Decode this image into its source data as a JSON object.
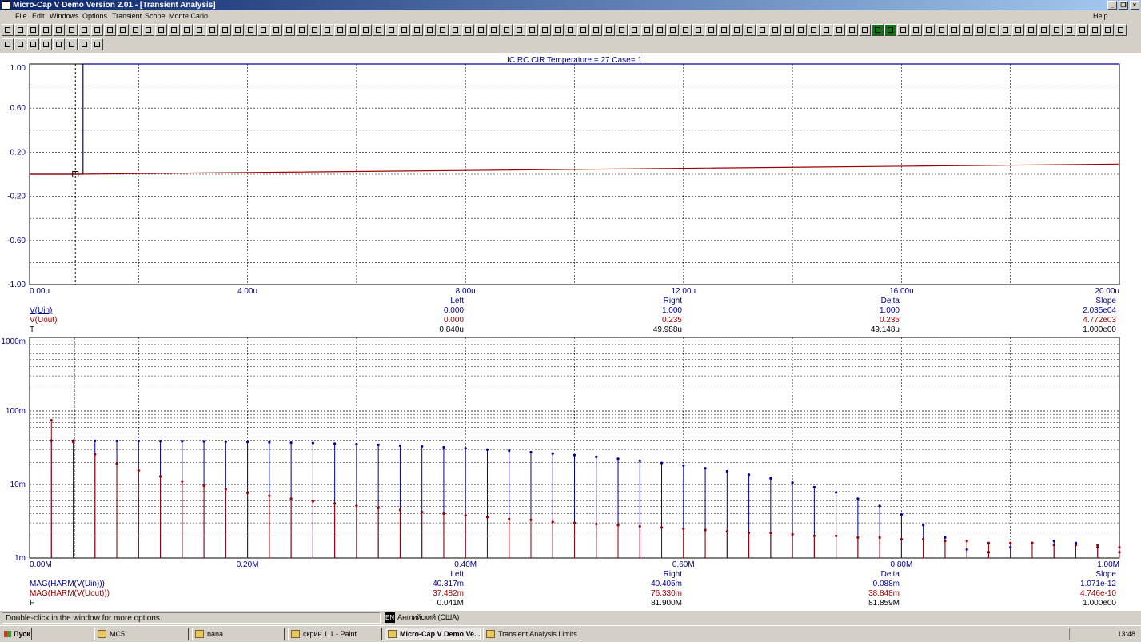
{
  "window": {
    "title": "Micro-Cap V Demo Version 2.01 - [Transient Analysis]",
    "help": "Help"
  },
  "menu": [
    "File",
    "Edit",
    "Windows",
    "Options",
    "Transient",
    "Scope",
    "Monte Carlo"
  ],
  "chart_data": [
    {
      "type": "line",
      "title": "IC  RC.CIR Temperature = 27 Case= 1",
      "xlim": [
        0,
        20
      ],
      "ylim": [
        -1.0,
        1.0
      ],
      "x_ticks": [
        "0.00u",
        "4.00u",
        "8.00u",
        "12.00u",
        "16.00u",
        "20.00u"
      ],
      "y_ticks": [
        "1.00",
        "0.60",
        "0.20",
        "-0.20",
        "-0.60",
        "-1.00"
      ],
      "grid": true,
      "series": [
        {
          "name": "V(Uin)",
          "color": "#0000a0",
          "x": [
            0,
            0.84,
            0.84,
            0.98,
            0.98,
            20
          ],
          "y": [
            0,
            0,
            0,
            0,
            1.0,
            1.0
          ]
        },
        {
          "name": "V(Uout)",
          "color": "#a00000",
          "x": [
            0,
            0.84,
            4,
            8,
            12,
            16,
            20
          ],
          "y": [
            0,
            0,
            0.016,
            0.035,
            0.054,
            0.073,
            0.092
          ]
        }
      ],
      "cursor": {
        "left_x": 0.84,
        "marker_y": 0
      },
      "readout": {
        "headers": [
          "Left",
          "Right",
          "Delta",
          "Slope"
        ],
        "rows": [
          {
            "label": "V(Uin)",
            "color": "#0000a0",
            "values": [
              "0.000",
              "1.000",
              "1.000",
              "2.035e04"
            ]
          },
          {
            "label": "V(Uout)",
            "color": "#a00000",
            "values": [
              "0.000",
              "0.235",
              "0.235",
              "4.772e03"
            ]
          },
          {
            "label": "T",
            "color": "#000000",
            "values": [
              "0.840u",
              "49.988u",
              "49.148u",
              "1.000e00"
            ]
          }
        ]
      }
    },
    {
      "type": "bar",
      "subtype": "stem",
      "xlim": [
        0,
        1.0
      ],
      "ylim": [
        0.001,
        1.0
      ],
      "y_scale": "log",
      "x_ticks": [
        "0.00M",
        "0.20M",
        "0.40M",
        "0.60M",
        "0.80M",
        "1.00M"
      ],
      "y_ticks": [
        "1000m",
        "100m",
        "10m",
        "1m"
      ],
      "grid": true,
      "harmonics": {
        "spacing": 0.02,
        "blue": [
          0.0395,
          0.0394,
          0.0393,
          0.0392,
          0.0391,
          0.039,
          0.0388,
          0.0386,
          0.0383,
          0.038,
          0.0376,
          0.0371,
          0.0366,
          0.036,
          0.0353,
          0.0346,
          0.0338,
          0.0329,
          0.032,
          0.031,
          0.0299,
          0.0288,
          0.0276,
          0.0264,
          0.0251,
          0.0238,
          0.0224,
          0.021,
          0.0196,
          0.0181,
          0.0166,
          0.0151,
          0.0136,
          0.0121,
          0.0106,
          0.0092,
          0.0078,
          0.0064,
          0.0051,
          0.0039,
          0.0028,
          0.0019,
          0.0013,
          0.0012,
          0.0014,
          0.0016,
          0.0017,
          0.0016,
          0.0014,
          0.0012,
          0.0011
        ],
        "red": [
          0.0749,
          0.038,
          0.0258,
          0.0193,
          0.0155,
          0.0129,
          0.011,
          0.0096,
          0.0086,
          0.0077,
          0.007,
          0.0064,
          0.0059,
          0.0055,
          0.0051,
          0.0048,
          0.0045,
          0.0042,
          0.004,
          0.0038,
          0.0036,
          0.0034,
          0.0033,
          0.0031,
          0.003,
          0.0029,
          0.0028,
          0.0027,
          0.0026,
          0.0025,
          0.0024,
          0.0023,
          0.0022,
          0.0022,
          0.0021,
          0.002,
          0.002,
          0.0019,
          0.0019,
          0.0018,
          0.0018,
          0.0017,
          0.0017,
          0.0016,
          0.0016,
          0.0016,
          0.0015,
          0.0015,
          0.0015,
          0.0014,
          0.0014
        ]
      },
      "readout": {
        "headers": [
          "Left",
          "Right",
          "Delta",
          "Slope"
        ],
        "rows": [
          {
            "label": "MAG(HARM(V(Uin)))",
            "color": "#0000a0",
            "values": [
              "40.317m",
              "40.405m",
              "0.088m",
              "1.071e-12"
            ]
          },
          {
            "label": "MAG(HARM(V(Uout)))",
            "color": "#a00000",
            "values": [
              "37.482m",
              "76.330m",
              "38.848m",
              "4.746e-10"
            ]
          },
          {
            "label": "F",
            "color": "#000000",
            "values": [
              "0.041M",
              "81.900M",
              "81.859M",
              "1.000e00"
            ]
          }
        ]
      }
    }
  ],
  "status": {
    "message": "Double-click in the window for more options.",
    "lang_code": "EN",
    "lang_name": "Английский (США)"
  },
  "taskbar": {
    "start": "Пуск",
    "items": [
      "MC5",
      "nana",
      "скрин 1.1 - Paint",
      "Micro-Cap V Demo Ve...",
      "Transient Analysis Limits"
    ],
    "clock": "13:48"
  }
}
